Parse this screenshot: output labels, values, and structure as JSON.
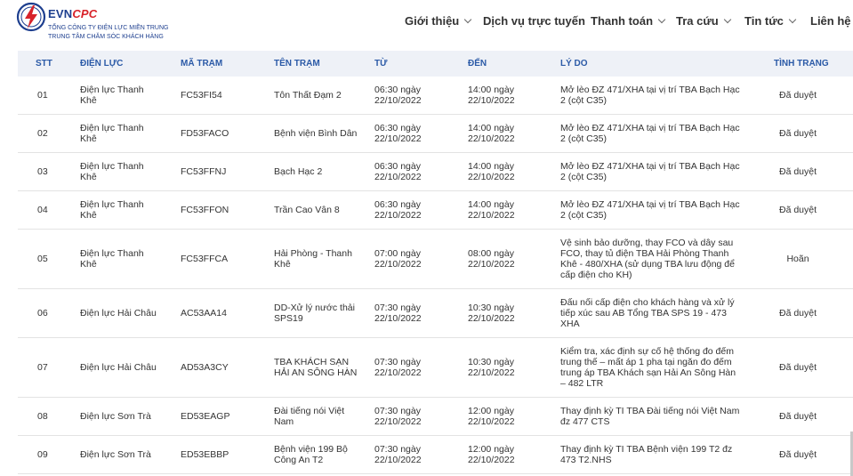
{
  "header": {
    "brand_a": "EVN",
    "brand_b": "CPC",
    "company": "TỔNG CÔNG TY ĐIỆN LỰC MIỀN TRUNG",
    "center": "TRUNG TÂM CHĂM SÓC KHÁCH HÀNG",
    "accent": "#1e3f8f",
    "brand_red": "#d8232a"
  },
  "nav": {
    "items": [
      {
        "label": "Giới thiệu",
        "has_dropdown": true
      },
      {
        "label": "Dịch vụ trực tuyến",
        "has_dropdown": false
      },
      {
        "label": "Thanh toán",
        "has_dropdown": true
      },
      {
        "label": "Tra cứu",
        "has_dropdown": true
      },
      {
        "label": "Tin tức",
        "has_dropdown": true
      },
      {
        "label": "Liên hệ",
        "has_dropdown": false
      }
    ]
  },
  "table": {
    "columns": [
      "STT",
      "ĐIỆN LỰC",
      "MÃ TRẠM",
      "TÊN TRẠM",
      "TỪ",
      "ĐẾN",
      "LÝ DO",
      "TÌNH TRẠNG"
    ],
    "rows": [
      {
        "stt": "01",
        "dien_luc": "Điện lực Thanh Khê",
        "ma_tram": "FC53FI54",
        "ten_tram": "Tôn Thất Đạm 2",
        "tu": "06:30 ngày 22/10/2022",
        "den": "14:00 ngày 22/10/2022",
        "ly_do": "Mở lèo ĐZ 471/XHA tại vị trí TBA Bạch Hạc 2 (cột C35)",
        "tinh_trang": "Đã duyệt"
      },
      {
        "stt": "02",
        "dien_luc": "Điện lực Thanh Khê",
        "ma_tram": "FD53FACO",
        "ten_tram": "Bệnh viện Bình Dân",
        "tu": "06:30 ngày 22/10/2022",
        "den": "14:00 ngày 22/10/2022",
        "ly_do": "Mở lèo ĐZ 471/XHA tại vị trí TBA Bạch Hạc 2 (cột C35)",
        "tinh_trang": "Đã duyệt"
      },
      {
        "stt": "03",
        "dien_luc": "Điện lực Thanh Khê",
        "ma_tram": "FC53FFNJ",
        "ten_tram": "Bạch Hạc 2",
        "tu": "06:30 ngày 22/10/2022",
        "den": "14:00 ngày 22/10/2022",
        "ly_do": "Mở lèo ĐZ 471/XHA tại vị trí TBA Bạch Hạc 2 (cột C35)",
        "tinh_trang": "Đã duyệt"
      },
      {
        "stt": "04",
        "dien_luc": "Điện lực Thanh Khê",
        "ma_tram": "FC53FFON",
        "ten_tram": "Trần Cao Vân 8",
        "tu": "06:30 ngày 22/10/2022",
        "den": "14:00 ngày 22/10/2022",
        "ly_do": "Mở lèo ĐZ 471/XHA tại vị trí TBA Bạch Hạc 2 (cột C35)",
        "tinh_trang": "Đã duyệt"
      },
      {
        "stt": "05",
        "dien_luc": "Điện lực Thanh Khê",
        "ma_tram": "FC53FFCA",
        "ten_tram": "Hải Phòng - Thanh Khê",
        "tu": "07:00 ngày 22/10/2022",
        "den": "08:00 ngày 22/10/2022",
        "ly_do": "Vệ sinh bảo dưỡng, thay FCO và dây sau FCO, thay tủ điện TBA Hải Phòng Thanh Khê - 480/XHA (sử dụng TBA lưu động để cấp điện cho KH)",
        "tinh_trang": "Hoãn"
      },
      {
        "stt": "06",
        "dien_luc": "Điện lực Hải Châu",
        "ma_tram": "AC53AA14",
        "ten_tram": "DD-Xử lý nước thải SPS19",
        "tu": "07:30 ngày 22/10/2022",
        "den": "10:30 ngày 22/10/2022",
        "ly_do": "Đấu nối cấp điện cho khách hàng và xử lý tiếp xúc sau AB Tổng TBA SPS 19 - 473 XHA",
        "tinh_trang": "Đã duyệt"
      },
      {
        "stt": "07",
        "dien_luc": "Điện lực Hải Châu",
        "ma_tram": "AD53A3CY",
        "ten_tram": "TBA KHÁCH SẠN HẢI AN SÔNG HÀN",
        "tu": "07:30 ngày 22/10/2022",
        "den": "10:30 ngày 22/10/2022",
        "ly_do": "Kiểm tra, xác định sự cố hệ thống đo đếm trung thế – mất áp 1 pha tại ngăn đo đếm trung áp TBA Khách sạn Hải An Sông Hàn – 482 LTR",
        "tinh_trang": "Đã duyệt"
      },
      {
        "stt": "08",
        "dien_luc": "Điện lực Sơn Trà",
        "ma_tram": "ED53EAGP",
        "ten_tram": "Đài tiếng nói Việt Nam",
        "tu": "07:30 ngày 22/10/2022",
        "den": "12:00 ngày 22/10/2022",
        "ly_do": "Thay định kỳ TI TBA Đài tiếng nói Việt Nam đz 477 CTS",
        "tinh_trang": "Đã duyệt"
      },
      {
        "stt": "09",
        "dien_luc": "Điện lực Sơn Trà",
        "ma_tram": "ED53EBBP",
        "ten_tram": "Bệnh viện 199 Bộ Công An T2",
        "tu": "07:30 ngày 22/10/2022",
        "den": "12:00 ngày 22/10/2022",
        "ly_do": "Thay định kỳ TI TBA Bệnh viện 199 T2 đz 473 T2.NHS",
        "tinh_trang": "Đã duyệt"
      }
    ]
  }
}
